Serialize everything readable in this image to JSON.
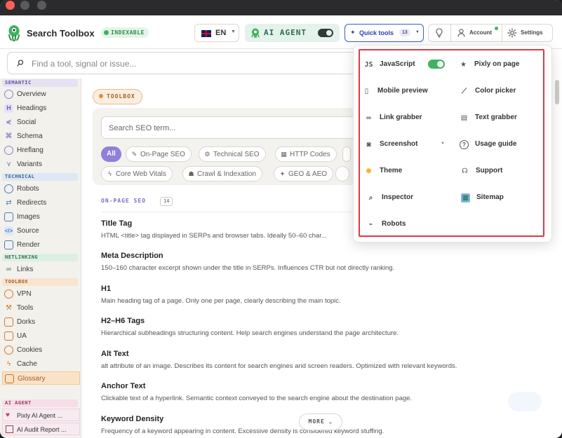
{
  "app": {
    "title": "Search Toolbox",
    "status_badge": "INDEXABLE"
  },
  "header": {
    "language": "EN",
    "ai_agent_label": "AI AGENT",
    "ai_agent_enabled": true,
    "quick_tools_label": "Quick tools",
    "quick_tools_count": "13",
    "account_label": "Account",
    "settings_label": "Settings"
  },
  "search": {
    "placeholder": "Find a tool, signal or issue..."
  },
  "sidebar": {
    "sections": {
      "semantic": "SEMANTIC",
      "technical": "TECHNICAL",
      "netlinking": "NETLINKING",
      "toolbox": "TOOLBOX",
      "ai_agent": "AI AGENT"
    },
    "semantic_items": [
      "Overview",
      "Headings",
      "Social",
      "Schema",
      "Hreflang",
      "Variants"
    ],
    "technical_items": [
      "Robots",
      "Redirects",
      "Images",
      "Source",
      "Render"
    ],
    "netlinking_items": [
      "Links"
    ],
    "toolbox_items": [
      "VPN",
      "Tools",
      "Dorks",
      "UA",
      "Cookies",
      "Cache",
      "Glossary"
    ],
    "ai_items": [
      "Pixly AI Agent ...",
      "AI Audit Report ..."
    ],
    "active_item": "Glossary"
  },
  "main": {
    "toolbox_pill": "TOOLBOX",
    "search_placeholder": "Search SEO term...",
    "chips": [
      "All",
      "On-Page SEO",
      "Technical SEO",
      "HTTP Codes",
      "Core Web Vitals",
      "Crawl & Indexation",
      "GEO & AEO"
    ],
    "section_title": "ON-PAGE SEO",
    "section_count": "14",
    "terms": [
      {
        "title": "Title Tag",
        "desc": "HTML <title> tag displayed in SERPs and browser tabs. Ideally 50–60 char..."
      },
      {
        "title": "Meta Description",
        "desc": "150–160 character excerpt shown under the title in SERPs. Influences CTR but not directly ranking."
      },
      {
        "title": "H1",
        "desc": "Main heading tag of a page. Only one per page, clearly describing the main topic."
      },
      {
        "title": "H2–H6 Tags",
        "desc": "Hierarchical subheadings structuring content. Help search engines understand the page architecture."
      },
      {
        "title": "Alt Text",
        "desc": "alt attribute of an image. Describes its content for search engines and screen readers. Optimized with relevant keywords."
      },
      {
        "title": "Anchor Text",
        "desc": "Clickable text of a hyperlink. Semantic context conveyed to the search engine about the destination page."
      },
      {
        "title": "Keyword Density",
        "desc": "Frequency of a keyword appearing in content. Excessive density is considered keyword stuffing."
      }
    ],
    "more_label": "MORE"
  },
  "quick_tools": {
    "js_tag": "JS",
    "left": [
      "JavaScript",
      "Mobile preview",
      "Link grabber",
      "Screenshot",
      "Theme",
      "Inspector",
      "Robots"
    ],
    "right": [
      "Pixly on page",
      "Color picker",
      "Text grabber",
      "Usage guide",
      "Support",
      "Sitemap"
    ],
    "javascript_enabled": true
  },
  "colors": {
    "accent": "#3b5bd6",
    "brand_green": "#3fb25e",
    "highlight_red": "#e8343f",
    "active_orange": "#fbe3c8"
  }
}
